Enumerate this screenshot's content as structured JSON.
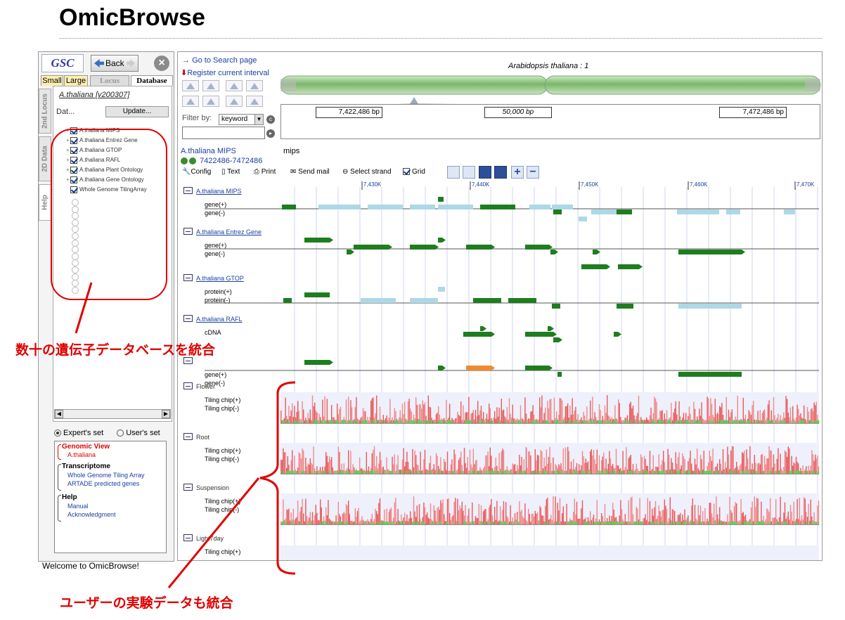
{
  "app_title": "OmicBrowse",
  "nav": {
    "back_label": "Back"
  },
  "tabs": [
    "Small",
    "Large",
    "Locus",
    "Database"
  ],
  "vertical_tabs": [
    "2nd Locus",
    "2D Data",
    "Help"
  ],
  "database_panel": {
    "version": "A.thaliana [v200307]",
    "list_label": "Dat...",
    "update_label": "Update...",
    "items": [
      {
        "label": "A.thaliana MIPS",
        "checked": true
      },
      {
        "label": "A.thaliana Entrez Gene",
        "checked": true
      },
      {
        "label": "A.thaliana GTOP",
        "checked": true
      },
      {
        "label": "A.thaliana RAFL",
        "checked": true
      },
      {
        "label": "A.thaliana Plant Ontology",
        "checked": true
      },
      {
        "label": "A.thaliana Gene Ontology",
        "checked": true
      },
      {
        "label": "Whole Genome TilingArray",
        "checked": true
      }
    ]
  },
  "sets": {
    "expert": "Expert's set",
    "user": "User's set"
  },
  "menu": {
    "genomic_view": "Genomic View",
    "genomic_sub": "A.thaliana",
    "transcriptome": "Transcriptome",
    "transcriptome_sub": [
      "Whole Genome Tiling Array",
      "ARTADE predicted genes"
    ],
    "help": "Help",
    "help_sub": [
      "Manual",
      "Acknowledgment"
    ]
  },
  "welcome": "Welcome to OmicBrowse!",
  "main": {
    "search_link": "Go to Search page",
    "register_link": "Register current interval",
    "filter_label": "Filter by:",
    "filter_value": "keyword",
    "organism": "Arabidopsis thaliana : 1",
    "coord_left": "7,422,486 bp",
    "coord_span": "50,000 bp",
    "coord_right": "7,472,486 bp",
    "track_db": "A.thaliana MIPS",
    "track_src": "mips",
    "interval": "7422486-7472486",
    "toolbar": [
      "Config",
      "Text",
      "Print",
      "Send mail",
      "Select strand",
      "Grid"
    ],
    "ruler_ticks": [
      "7,430K",
      "7,440K",
      "7,450K",
      "7,460K",
      "7,470K"
    ],
    "sections": [
      {
        "title": "A.thaliana MIPS",
        "tracks": [
          "gene(+)",
          "gene(-)"
        ]
      },
      {
        "title": "A.thaliana Entrez Gene",
        "tracks": [
          "gene(+)",
          "gene(-)"
        ]
      },
      {
        "title": "A.thaliana GTOP",
        "tracks": [
          "protein(+)",
          "protein(-)"
        ]
      },
      {
        "title": "A.thaliana RAFL",
        "tracks": [
          "cDNA"
        ]
      },
      {
        "title": "",
        "tracks": [
          "gene(+)",
          "gene(-)"
        ]
      },
      {
        "title": "Flower",
        "tracks": [
          "Tiling chip(+)",
          "Tiling chip(-)"
        ]
      },
      {
        "title": "Root",
        "tracks": [
          "Tiling chip(+)",
          "Tiling chip(-)"
        ]
      },
      {
        "title": "Suspension",
        "tracks": [
          "Tiling chip(+)",
          "Tiling chip(-)"
        ]
      },
      {
        "title": "Light7day",
        "tracks": [
          "Tiling chip(+)"
        ]
      }
    ]
  },
  "annotations": {
    "db_integration": "数十の遺伝子データベースを統合",
    "user_data": "ユーザーの実験データも統合"
  },
  "colors": {
    "gene_dark": "#1e7d1e",
    "gene_light": "#add8e6",
    "tiling": "#e85a5a",
    "annotation": "#e00000"
  }
}
